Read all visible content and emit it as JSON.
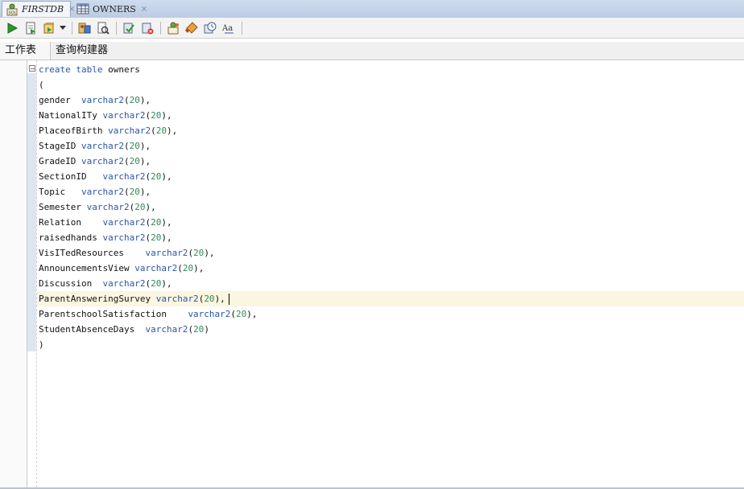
{
  "tabs": [
    {
      "label": "FIRSTDB",
      "icon": "sql-worksheet-icon",
      "active": true
    },
    {
      "label": "OWNERS",
      "icon": "table-icon",
      "active": false
    }
  ],
  "tab_close_glyph": "×",
  "toolbar": {
    "buttons": [
      {
        "name": "run-statement-icon"
      },
      {
        "name": "run-script-icon"
      },
      {
        "name": "autotrace-icon"
      },
      {
        "name": "explain-plan-icon"
      },
      {
        "name": "sql-tuning-advisor-icon"
      },
      {
        "name": "commit-icon"
      },
      {
        "name": "rollback-icon"
      },
      {
        "name": "unshared-sql-worksheet-icon"
      },
      {
        "name": "clear-icon"
      },
      {
        "name": "sql-history-icon"
      },
      {
        "name": "format-case-icon"
      }
    ]
  },
  "subtabs": {
    "worksheet": "工作表",
    "query_builder": "查询构建器"
  },
  "editor": {
    "fold_glyph": "−",
    "lines": [
      [
        {
          "t": "create table",
          "c": "kw"
        },
        {
          "t": " owners"
        }
      ],
      [
        {
          "t": "("
        }
      ],
      [
        {
          "t": "gender  "
        },
        {
          "t": "varchar2",
          "c": "kw"
        },
        {
          "t": "("
        },
        {
          "t": "20",
          "c": "num"
        },
        {
          "t": "),"
        }
      ],
      [
        {
          "t": "NationalITy "
        },
        {
          "t": "varchar2",
          "c": "kw"
        },
        {
          "t": "("
        },
        {
          "t": "20",
          "c": "num"
        },
        {
          "t": "),"
        }
      ],
      [
        {
          "t": "PlaceofBirth "
        },
        {
          "t": "varchar2",
          "c": "kw"
        },
        {
          "t": "("
        },
        {
          "t": "20",
          "c": "num"
        },
        {
          "t": "),"
        }
      ],
      [
        {
          "t": "StageID "
        },
        {
          "t": "varchar2",
          "c": "kw"
        },
        {
          "t": "("
        },
        {
          "t": "20",
          "c": "num"
        },
        {
          "t": "),"
        }
      ],
      [
        {
          "t": "GradeID "
        },
        {
          "t": "varchar2",
          "c": "kw"
        },
        {
          "t": "("
        },
        {
          "t": "20",
          "c": "num"
        },
        {
          "t": "),"
        }
      ],
      [
        {
          "t": "SectionID   "
        },
        {
          "t": "varchar2",
          "c": "kw"
        },
        {
          "t": "("
        },
        {
          "t": "20",
          "c": "num"
        },
        {
          "t": "),"
        }
      ],
      [
        {
          "t": "Topic   "
        },
        {
          "t": "varchar2",
          "c": "kw"
        },
        {
          "t": "("
        },
        {
          "t": "20",
          "c": "num"
        },
        {
          "t": "),"
        }
      ],
      [
        {
          "t": "Semester "
        },
        {
          "t": "varchar2",
          "c": "kw"
        },
        {
          "t": "("
        },
        {
          "t": "20",
          "c": "num"
        },
        {
          "t": "),"
        }
      ],
      [
        {
          "t": "Relation    "
        },
        {
          "t": "varchar2",
          "c": "kw"
        },
        {
          "t": "("
        },
        {
          "t": "20",
          "c": "num"
        },
        {
          "t": "),"
        }
      ],
      [
        {
          "t": "raisedhands "
        },
        {
          "t": "varchar2",
          "c": "kw"
        },
        {
          "t": "("
        },
        {
          "t": "20",
          "c": "num"
        },
        {
          "t": "),"
        }
      ],
      [
        {
          "t": "VisITedResources    "
        },
        {
          "t": "varchar2",
          "c": "kw"
        },
        {
          "t": "("
        },
        {
          "t": "20",
          "c": "num"
        },
        {
          "t": "),"
        }
      ],
      [
        {
          "t": "AnnouncementsView "
        },
        {
          "t": "varchar2",
          "c": "kw"
        },
        {
          "t": "("
        },
        {
          "t": "20",
          "c": "num"
        },
        {
          "t": "),"
        }
      ],
      [
        {
          "t": "Discussion  "
        },
        {
          "t": "varchar2",
          "c": "kw"
        },
        {
          "t": "("
        },
        {
          "t": "20",
          "c": "num"
        },
        {
          "t": "),"
        }
      ],
      [
        {
          "t": "ParentAnsweringSurvey "
        },
        {
          "t": "varchar2",
          "c": "kw"
        },
        {
          "t": "("
        },
        {
          "t": "20",
          "c": "num"
        },
        {
          "t": "),"
        }
      ],
      [
        {
          "t": "ParentschoolSatisfaction    "
        },
        {
          "t": "varchar2",
          "c": "kw"
        },
        {
          "t": "("
        },
        {
          "t": "20",
          "c": "num"
        },
        {
          "t": "),"
        }
      ],
      [
        {
          "t": "StudentAbsenceDays  "
        },
        {
          "t": "varchar2",
          "c": "kw"
        },
        {
          "t": "("
        },
        {
          "t": "20",
          "c": "num"
        },
        {
          "t": ")"
        }
      ],
      [
        {
          "t": ")"
        }
      ]
    ],
    "caret_line_index": 15
  },
  "colors": {
    "keyword": "#2a55a5",
    "number": "#2e8b57",
    "current_line": "#fbf6e0",
    "tabstrip": "#c7d5ea"
  }
}
